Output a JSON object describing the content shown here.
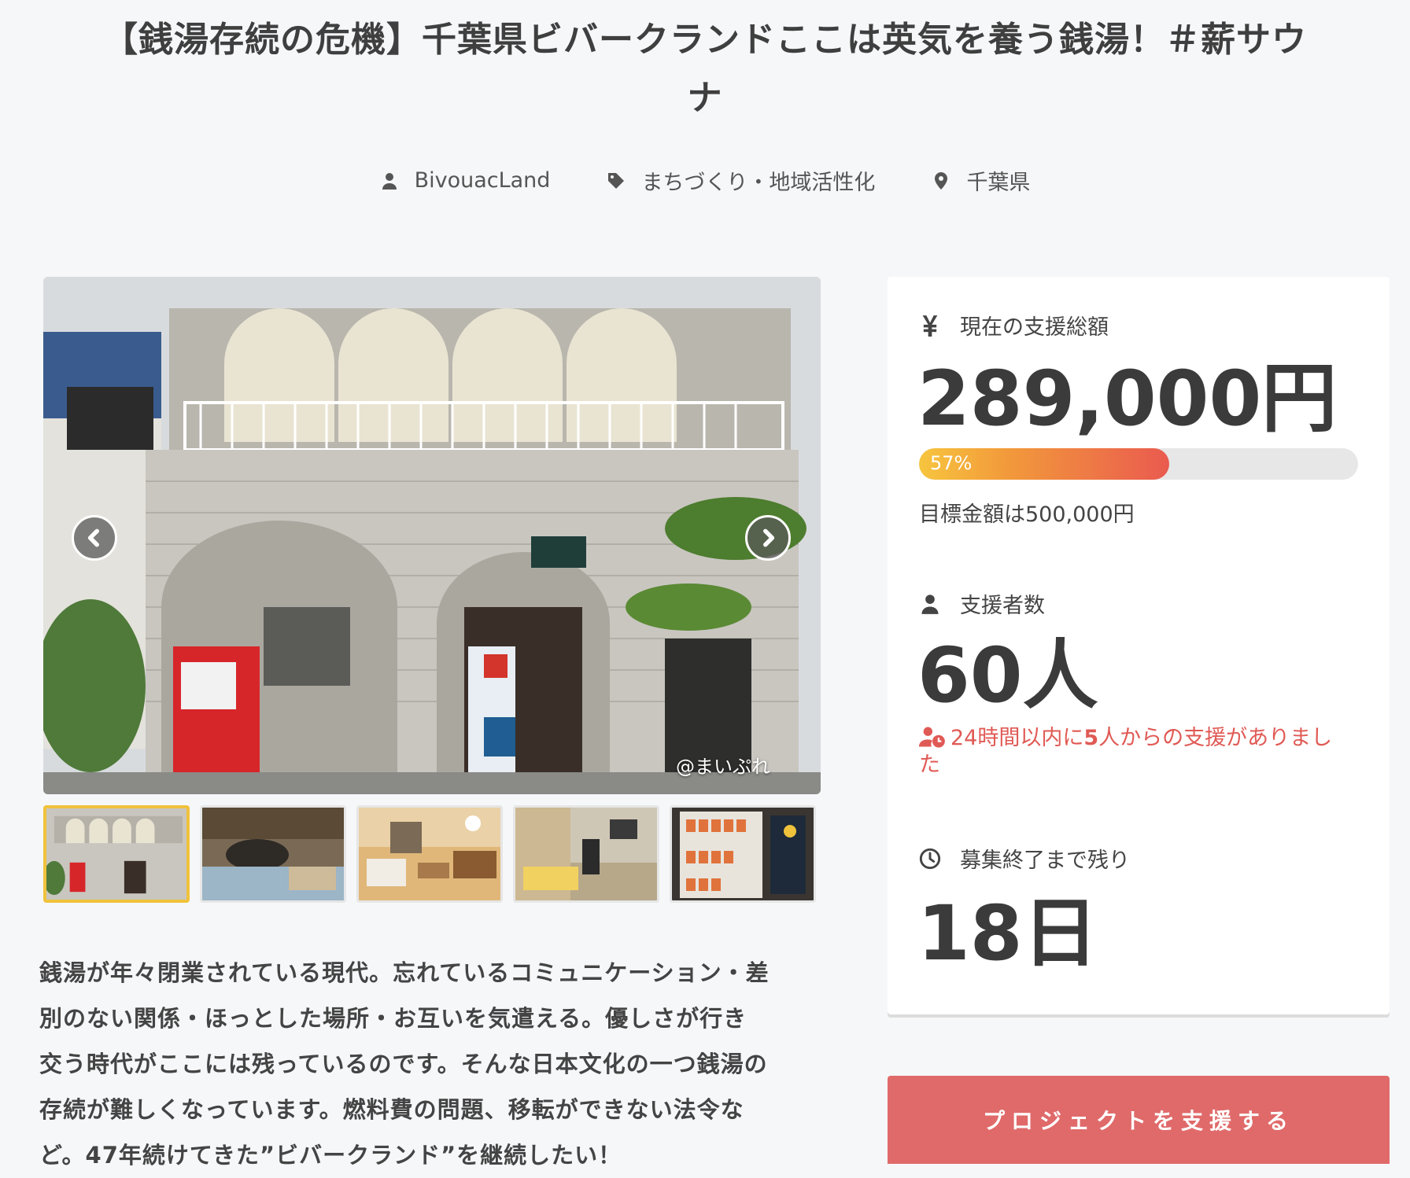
{
  "project": {
    "title_line1": "【銭湯存続の危機】千葉県ビバークランドここは英気を養う銭湯！＃薪サウ",
    "title_line2": "ナ",
    "owner": "BivouacLand",
    "category": "まちづくり・地域活性化",
    "location": "千葉県"
  },
  "gallery": {
    "credit": "@まいぷれ",
    "thumbnails": [
      "exterior",
      "bath",
      "lounge",
      "sauna",
      "drinks"
    ],
    "active_index": 0
  },
  "description": {
    "line1": "銭湯が年々閉業されている現代。忘れているコミュニケーション・差",
    "line2": "別のない関係・ほっとした場所・お互いを気遣える。優しさが行き",
    "line3": "交う時代がここには残っているのです。そんな日本文化の一つ銭湯の",
    "line4": "存続が難しくなっています。燃料費の問題、移転ができない法令な",
    "line5": "ど。47年続けてきた”ビバークランド”を継続したい！"
  },
  "stats": {
    "total_label": "現在の支援総額",
    "total_amount": "289,000円",
    "progress_percent": 57,
    "progress_text": "57%",
    "goal_text": "目標金額は500,000円",
    "supporters_label": "支援者数",
    "supporters_count": "60人",
    "recent_prefix": "24時間以内に",
    "recent_count": "5",
    "recent_suffix": "人からの支援がありまし",
    "recent_suffix2": "た",
    "remaining_label": "募集終了まで残り",
    "remaining_days": "18日"
  },
  "actions": {
    "support_button": "プロジェクトを支援する"
  },
  "colors": {
    "accent": "#e06a6a",
    "active_thumb_border": "#f0c23c",
    "recent_text": "#e05a55"
  }
}
